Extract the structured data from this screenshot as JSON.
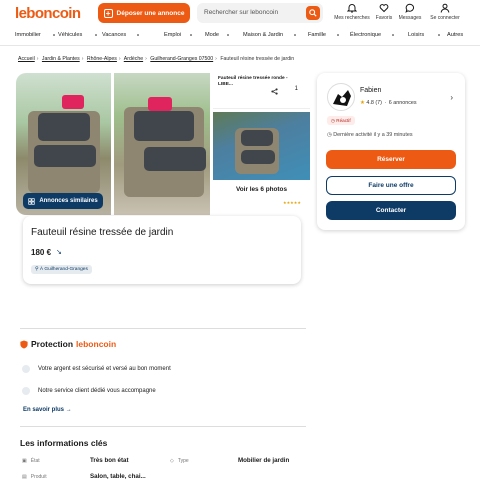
{
  "header": {
    "logo": "leboncoin",
    "post_label": "Déposer une annonce",
    "search_placeholder": "Rechercher sur leboncoin",
    "icons": [
      {
        "name": "bell-icon",
        "label": "Mes recherches"
      },
      {
        "name": "heart-icon",
        "label": "Favoris"
      },
      {
        "name": "message-icon",
        "label": "Messages"
      },
      {
        "name": "user-icon",
        "label": "Se connecter"
      }
    ]
  },
  "categories": [
    "Immobilier",
    "Véhicules",
    "Vacances",
    "Emploi",
    "Mode",
    "Maison & Jardin",
    "Famille",
    "Électronique",
    "Loisirs",
    "Autres"
  ],
  "breadcrumb": [
    "Accueil",
    "Jardin & Plantes",
    "Rhône-Alpes",
    "Ardèche",
    "Guilherand-Granges 07500"
  ],
  "breadcrumb_current": "Fauteuil résine tressée de jardin",
  "gallery": {
    "similar_label": "Annonces similaires",
    "mini_title": "Fauteuil résine tressée ronde - LIBE...",
    "fav_count": "1",
    "see_all": "Voir les 6 photos"
  },
  "ad": {
    "title": "Fauteuil résine tressée de jardin",
    "price": "180 €",
    "location": "À Guilherand-Granges"
  },
  "seller": {
    "name": "Fabien",
    "rating": "4.8",
    "rating_count": "(7)",
    "ads": "6 annonces",
    "badge": "Réactif",
    "last_activity": "Dernière activité il y a 39 minutes",
    "reserve_label": "Réserver",
    "offer_label": "Faire une offre",
    "contact_label": "Contacter"
  },
  "protection": {
    "title_prefix": "Protection",
    "title_brand": "leboncoin",
    "items": [
      "Votre argent est sécurisé et versé au bon moment",
      "Notre service client dédié vous accompagne"
    ],
    "more_label": "En savoir plus"
  },
  "info": {
    "title": "Les informations clés",
    "rows": [
      {
        "label": "État",
        "value": "Très bon état"
      },
      {
        "label": "Type",
        "value": "Mobilier de jardin"
      },
      {
        "label": "Produit",
        "value": "Salon, table, chai..."
      }
    ]
  },
  "colors": {
    "brand": "#ec5a13",
    "navy": "#0d3b66"
  }
}
